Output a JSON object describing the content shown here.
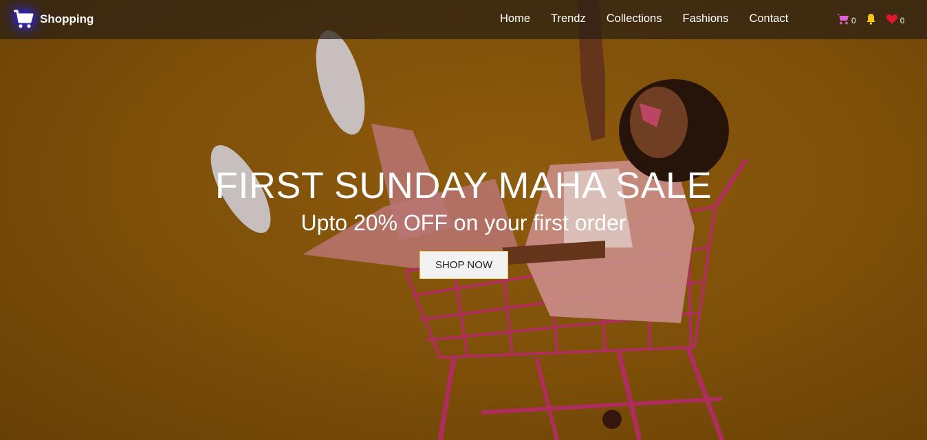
{
  "brand": {
    "name": "Shopping",
    "icon": "cart-icon",
    "icon_color": "#ffffff",
    "glow_color": "#2b2bff"
  },
  "nav": {
    "links": [
      "Home",
      "Trendz",
      "Collections",
      "Fashions",
      "Contact"
    ]
  },
  "nav_icons": {
    "cart": {
      "icon": "cart-icon",
      "color": "#e65ed8",
      "count": "0"
    },
    "notifications": {
      "icon": "bell-icon",
      "color": "#f5c518"
    },
    "wishlist": {
      "icon": "heart-icon",
      "color": "#e0182d",
      "count": "0"
    }
  },
  "hero": {
    "headline": "FIRST SUNDAY MAHA SALE",
    "subline": "Upto 20% OFF on your first order",
    "cta_label": "SHOP NOW",
    "background_color": "#8a5a0c"
  }
}
